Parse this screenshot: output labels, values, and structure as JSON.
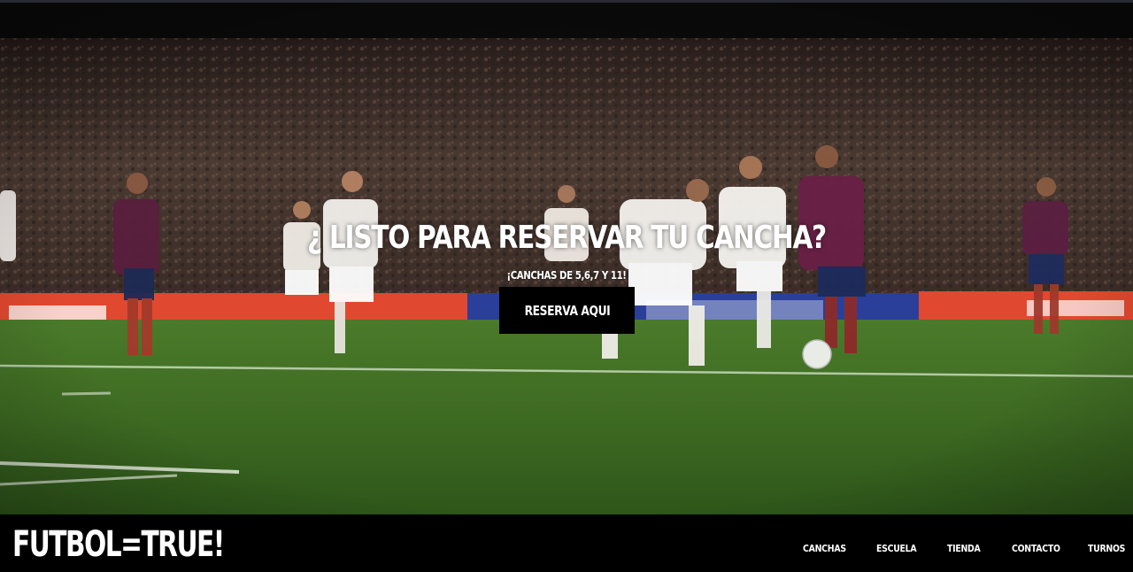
{
  "hero": {
    "title": "¿ LISTO PARA RESERVAR TU CANCHA?",
    "subtitle": "¡CANCHAS DE 5,6,7 Y 11!",
    "cta_label": "RESERVA AQUI",
    "background_image": "soccer-match-photo"
  },
  "footer": {
    "brand": "FUTBOL=TRUE!",
    "nav": [
      {
        "label": "CANCHAS"
      },
      {
        "label": "ESCUELA"
      },
      {
        "label": "TIENDA"
      },
      {
        "label": "CONTACTO"
      },
      {
        "label": "TURNOS"
      }
    ]
  },
  "colors": {
    "footer_background": "#000000",
    "button_background": "#000000",
    "text": "#ffffff",
    "pitch_green": "#3f6a22"
  }
}
